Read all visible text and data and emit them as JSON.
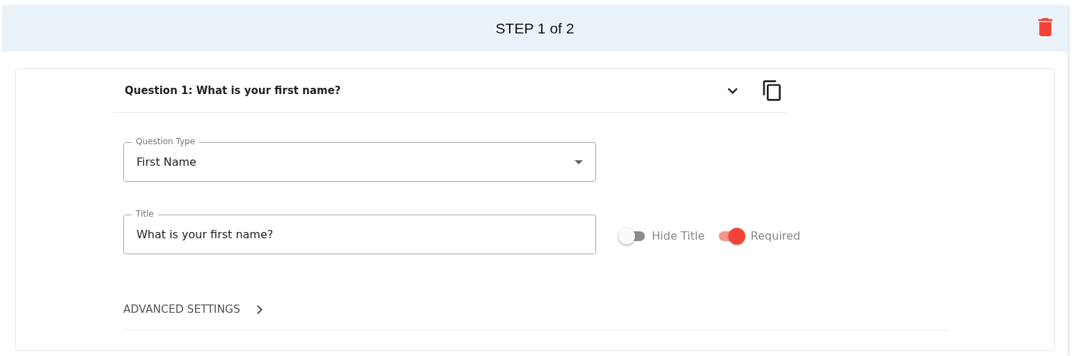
{
  "step": {
    "title": "STEP 1 of 2"
  },
  "question": {
    "title": "Question 1: What is your first name?",
    "expanded": true,
    "fields": [
      {
        "kind": "select",
        "label": "Question Type",
        "value": "First Name"
      },
      {
        "kind": "text",
        "label": "Title",
        "value": "What is your first name?"
      }
    ],
    "toggles": [
      {
        "label": "Hide Title",
        "on": false
      },
      {
        "label": "Required",
        "on": true
      }
    ],
    "advanced": {
      "label": "ADVANCED SETTINGS",
      "expanded": false
    }
  }
}
